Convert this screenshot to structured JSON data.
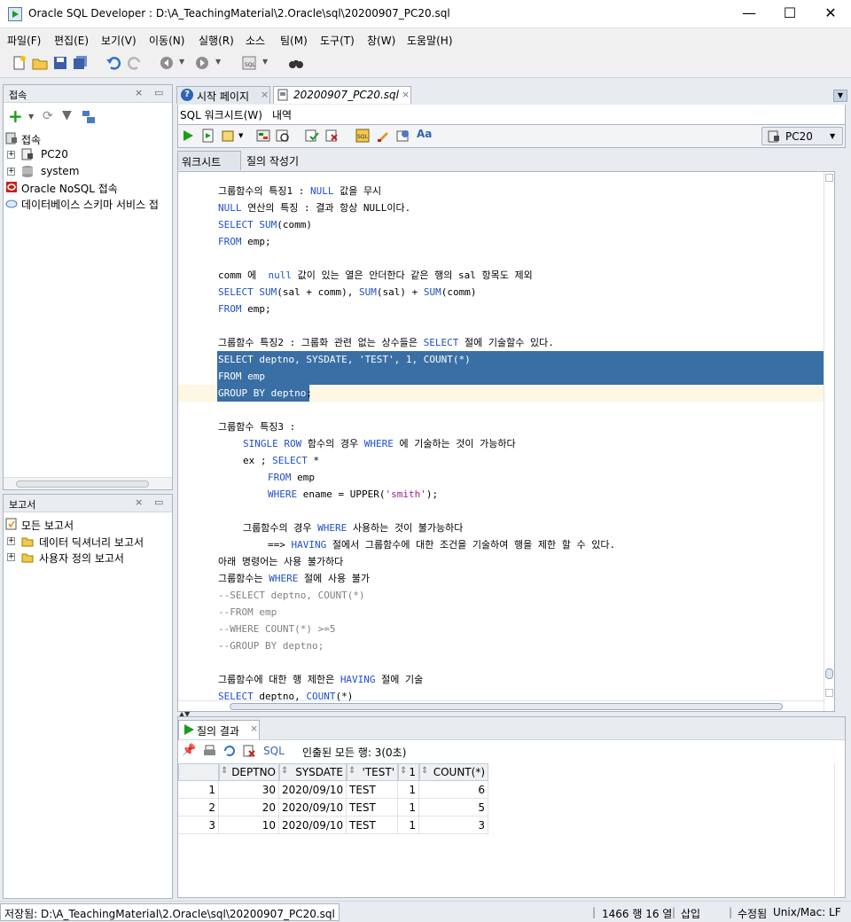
{
  "window": {
    "title": "Oracle SQL Developer : D:\\A_TeachingMaterial\\2.Oracle\\sql\\20200907_PC20.sql",
    "minimize": "—",
    "maximize": "☐",
    "close": "✕"
  },
  "menu": [
    "파일(F)",
    "편집(E)",
    "보기(V)",
    "이동(N)",
    "실행(R)",
    "소스",
    "팀(M)",
    "도구(T)",
    "창(W)",
    "도움말(H)"
  ],
  "connections_panel": {
    "title": "접속",
    "root": "접속",
    "items": [
      "PC20",
      "system"
    ],
    "nosql": "Oracle NoSQL 접속",
    "schema": "데이터베이스 스키마 서비스 접"
  },
  "reports_panel": {
    "title": "보고서",
    "items": [
      "모든 보고서",
      "데이터 딕셔너리 보고서",
      "사용자 정의 보고서"
    ]
  },
  "doc_tabs": [
    "시작 페이지",
    "20200907_PC20.sql"
  ],
  "sub_tabs": [
    "SQL 워크시트(W)",
    "내역"
  ],
  "connection_select": "PC20",
  "editor_tabs": [
    "워크시트",
    "질의 작성기"
  ],
  "code": [
    {
      "indent": 0,
      "parts": [
        [
          "t",
          "그룹함수의 특징1 : "
        ],
        [
          "k",
          "NULL"
        ],
        [
          "t",
          " 값을 무시"
        ]
      ]
    },
    {
      "indent": 0,
      "parts": [
        [
          "k",
          "NULL"
        ],
        [
          "t",
          " 연산의 특징 : 결과 항상 NULL이다."
        ]
      ]
    },
    {
      "indent": 0,
      "parts": [
        [
          "k",
          "SELECT"
        ],
        [
          "t",
          " "
        ],
        [
          "k",
          "SUM"
        ],
        [
          "t",
          "(comm)"
        ]
      ]
    },
    {
      "indent": 0,
      "parts": [
        [
          "k",
          "FROM"
        ],
        [
          "t",
          " emp;"
        ]
      ]
    },
    {
      "indent": 0,
      "parts": []
    },
    {
      "indent": 0,
      "parts": [
        [
          "t",
          "comm 에  "
        ],
        [
          "k",
          "null"
        ],
        [
          "t",
          " 값이 있는 열은 안더한다 같은 행의 sal 항목도 제외"
        ]
      ]
    },
    {
      "indent": 0,
      "parts": [
        [
          "k",
          "SELECT"
        ],
        [
          "t",
          " "
        ],
        [
          "k",
          "SUM"
        ],
        [
          "t",
          "(sal + comm), "
        ],
        [
          "k",
          "SUM"
        ],
        [
          "t",
          "(sal) + "
        ],
        [
          "k",
          "SUM"
        ],
        [
          "t",
          "(comm)"
        ]
      ]
    },
    {
      "indent": 0,
      "parts": [
        [
          "k",
          "FROM"
        ],
        [
          "t",
          " emp;"
        ]
      ]
    },
    {
      "indent": 0,
      "parts": []
    },
    {
      "indent": 0,
      "parts": [
        [
          "t",
          "그룹함수 특징2 : 그룹화 관련 없는 상수들은 "
        ],
        [
          "k",
          "SELECT"
        ],
        [
          "t",
          " 절에 기술할수 있다."
        ]
      ]
    },
    {
      "indent": 0,
      "sel": true,
      "parts": [
        [
          "t",
          "SELECT deptno, SYSDATE, 'TEST', 1, COUNT(*)"
        ]
      ]
    },
    {
      "indent": 0,
      "sel": true,
      "parts": [
        [
          "t",
          "FROM emp"
        ]
      ]
    },
    {
      "indent": 0,
      "selpart": true,
      "parts": [
        [
          "t",
          "GROUP BY deptno"
        ],
        [
          "p",
          ";"
        ]
      ]
    },
    {
      "indent": 0,
      "parts": []
    },
    {
      "indent": 0,
      "parts": [
        [
          "t",
          "그룹함수 특징3 :"
        ]
      ]
    },
    {
      "indent": 4,
      "parts": [
        [
          "k",
          "SINGLE"
        ],
        [
          "t",
          " "
        ],
        [
          "k",
          "ROW"
        ],
        [
          "t",
          " 함수의 경우 "
        ],
        [
          "k",
          "WHERE"
        ],
        [
          "t",
          " 에 기술하는 것이 가능하다"
        ]
      ]
    },
    {
      "indent": 4,
      "parts": [
        [
          "t",
          "ex ; "
        ],
        [
          "k",
          "SELECT"
        ],
        [
          "t",
          " *"
        ]
      ]
    },
    {
      "indent": 8,
      "parts": [
        [
          "k",
          "FROM"
        ],
        [
          "t",
          " emp"
        ]
      ]
    },
    {
      "indent": 8,
      "parts": [
        [
          "k",
          "WHERE"
        ],
        [
          "t",
          " ename = UPPER("
        ],
        [
          "s",
          "'smith'"
        ],
        [
          "t",
          ");"
        ]
      ]
    },
    {
      "indent": 0,
      "parts": []
    },
    {
      "indent": 4,
      "parts": [
        [
          "t",
          "그룹함수의 경우 "
        ],
        [
          "k",
          "WHERE"
        ],
        [
          "t",
          " 사용하는 것이 불가능하다"
        ]
      ]
    },
    {
      "indent": 8,
      "parts": [
        [
          "t",
          "==> "
        ],
        [
          "k",
          "HAVING"
        ],
        [
          "t",
          " 절에서 그룹함수에 대한 조건을 기술하여 행을 제한 할 수 있다."
        ]
      ]
    },
    {
      "indent": 0,
      "parts": [
        [
          "t",
          "아래 명령어는 사용 불가하다"
        ]
      ]
    },
    {
      "indent": 0,
      "parts": [
        [
          "t",
          "그룹함수는 "
        ],
        [
          "k",
          "WHERE"
        ],
        [
          "t",
          " 절에 사용 불가"
        ]
      ]
    },
    {
      "indent": 0,
      "parts": [
        [
          "c",
          "--SELECT deptno, COUNT(*)"
        ]
      ]
    },
    {
      "indent": 0,
      "parts": [
        [
          "c",
          "--FROM emp"
        ]
      ]
    },
    {
      "indent": 0,
      "parts": [
        [
          "c",
          "--WHERE COUNT(*) >=5"
        ]
      ]
    },
    {
      "indent": 0,
      "parts": [
        [
          "c",
          "--GROUP BY deptno;"
        ]
      ]
    },
    {
      "indent": 0,
      "parts": []
    },
    {
      "indent": 0,
      "parts": [
        [
          "t",
          "그룹함수에 대한 행 제한은 "
        ],
        [
          "k",
          "HAVING"
        ],
        [
          "t",
          " 절에 기술"
        ]
      ]
    },
    {
      "indent": 0,
      "parts": [
        [
          "k",
          "SELECT"
        ],
        [
          "t",
          " deptno, "
        ],
        [
          "k",
          "COUNT"
        ],
        [
          "t",
          "(*)"
        ]
      ]
    }
  ],
  "results": {
    "tab": "질의 결과",
    "sql_link": "SQL",
    "status": "인출된 모든 행: 3(0초)",
    "columns": [
      "DEPTNO",
      "SYSDATE",
      "'TEST'",
      "1",
      "COUNT(*)"
    ],
    "rows": [
      {
        "n": "1",
        "cells": [
          "30",
          "2020/09/10",
          "TEST",
          "1",
          "6"
        ]
      },
      {
        "n": "2",
        "cells": [
          "20",
          "2020/09/10",
          "TEST",
          "1",
          "5"
        ]
      },
      {
        "n": "3",
        "cells": [
          "10",
          "2020/09/10",
          "TEST",
          "1",
          "3"
        ]
      }
    ]
  },
  "status": {
    "saved": "저장됨: D:\\A_TeachingMaterial\\2.Oracle\\sql\\20200907_PC20.sql",
    "pos": "1466 행 16 열",
    "insert": "삽입",
    "modified": "수정됨",
    "eol": "Unix/Mac: LF"
  }
}
